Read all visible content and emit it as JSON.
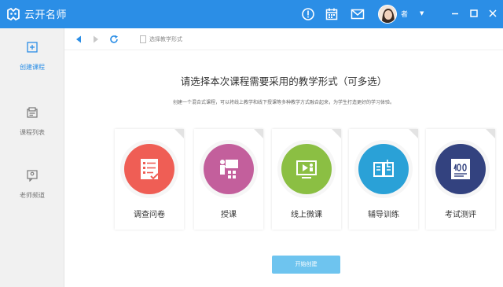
{
  "app": {
    "title": "云开名师",
    "username": "者"
  },
  "colors": {
    "brand": "#2b8ee6",
    "button": "#6ec4ef"
  },
  "sidebar": {
    "items": [
      {
        "label": "创建课程",
        "icon": "create-course-icon",
        "active": true
      },
      {
        "label": "课程列表",
        "icon": "course-list-icon",
        "active": false
      },
      {
        "label": "老师频道",
        "icon": "teacher-channel-icon",
        "active": false
      }
    ]
  },
  "nav": {
    "address": "选择教学形式"
  },
  "main": {
    "heading": "请选择本次课程需要采用的教学形式（可多选）",
    "subtext": "创建一个混合式课程，可以将线上教学和线下授课等多种教学方式融合起来，为学生打造更好的学习体验。",
    "cards": [
      {
        "label": "调查问卷",
        "icon": "survey-icon",
        "color": "#ef5e55"
      },
      {
        "label": "授课",
        "icon": "lecture-icon",
        "color": "#c35f9c"
      },
      {
        "label": "线上微课",
        "icon": "online-video-icon",
        "color": "#8bbf43"
      },
      {
        "label": "辅导训练",
        "icon": "tutoring-book-icon",
        "color": "#2aa1d7"
      },
      {
        "label": "考试测评",
        "icon": "exam-icon",
        "color": "#33427f"
      }
    ],
    "start_button": "开始创建"
  }
}
